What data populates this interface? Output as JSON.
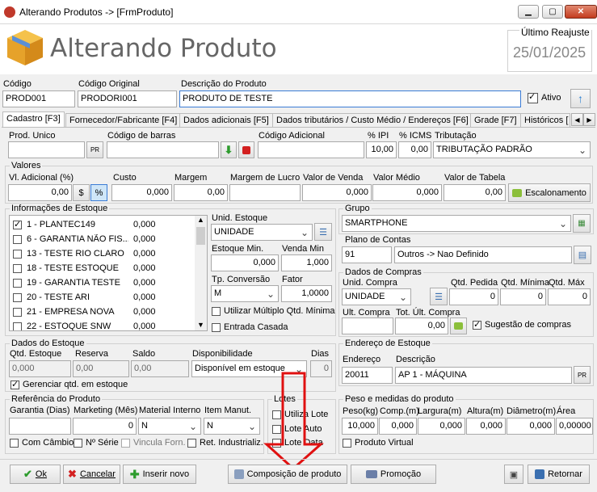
{
  "window": {
    "title": "Alterando Produtos   ->   [FrmProduto]",
    "min": "▁",
    "max": "▢",
    "close": "✕"
  },
  "header": {
    "title": "Alterando Produto",
    "reajuste_label": "Último Reajuste",
    "reajuste_value": "25/01/2025"
  },
  "top": {
    "codigo_label": "Código",
    "codigo": "PROD001",
    "codorig_label": "Código Original",
    "codorig": "PRODORI001",
    "desc_label": "Descrição do Produto",
    "desc": "PRODUTO DE TESTE",
    "ativo_label": "Ativo"
  },
  "tabs": [
    "Cadastro [F3]",
    "Fornecedor/Fabricante [F4]",
    "Dados adicionais [F5]",
    "Dados tributários / Custo Médio / Endereços [F6]",
    "Grade [F7]",
    "Históricos ["
  ],
  "row1": {
    "prod_unico": "Prod. Unico",
    "pr": "PR",
    "codbarras": "Código de barras",
    "codadic": "Código Adicional",
    "ipi_label": "% IPI",
    "ipi": "10,00",
    "icms_label": "% ICMS",
    "icms": "0,00",
    "trib_label": "Tributação",
    "trib": "TRIBUTAÇÃO PADRÃO"
  },
  "valores": {
    "title": "Valores",
    "adic_label": "Vl. Adicional (%)",
    "adic": "0,00",
    "dollar": "$",
    "pct": "%",
    "custo_label": "Custo",
    "custo": "0,000",
    "margem_label": "Margem",
    "margem": "0,00",
    "margemlucro_label": "Margem de Lucro",
    "margemlucro": "",
    "venda_label": "Valor de Venda",
    "venda": "0,000",
    "medio_label": "Valor Médio",
    "medio": "0,000",
    "tabela_label": "Valor de Tabela",
    "tabela": "0,00",
    "escal": "Escalonamento"
  },
  "estoque": {
    "title": "Informações de Estoque",
    "items": [
      {
        "name": "1 - PLANTEC149",
        "qty": "0,000",
        "checked": true
      },
      {
        "name": "6 - GARANTIA NÃO FIS...",
        "qty": "0,000",
        "checked": false
      },
      {
        "name": "13 - TESTE RIO CLARO",
        "qty": "0,000",
        "checked": false
      },
      {
        "name": "18 - TESTE ESTOQUE",
        "qty": "0,000",
        "checked": false
      },
      {
        "name": "19 - GARANTIA TESTE",
        "qty": "0,000",
        "checked": false
      },
      {
        "name": "20 - TESTE ARI",
        "qty": "0,000",
        "checked": false
      },
      {
        "name": "21 - EMPRESA NOVA",
        "qty": "0,000",
        "checked": false
      },
      {
        "name": "22 - ESTOQUE SNW",
        "qty": "0,000",
        "checked": false
      }
    ],
    "unid_label": "Unid. Estoque",
    "unid": "UNIDADE",
    "emin_label": "Estoque Min.",
    "emin": "0,000",
    "vmin_label": "Venda Min",
    "vmin": "1,000",
    "tpconv_label": "Tp. Conversão",
    "tpconv": "M",
    "fator_label": "Fator",
    "fator": "1,0000",
    "multiplo": "Utilizar Múltiplo Qtd. Mínima",
    "casada": "Entrada Casada"
  },
  "grupo": {
    "title": "Grupo",
    "value": "SMARTPHONE"
  },
  "plano": {
    "title": "Plano de Contas",
    "code": "91",
    "value": "Outros -> Nao Definido"
  },
  "compras": {
    "title": "Dados de Compras",
    "unid_label": "Unid. Compra",
    "unid": "UNIDADE",
    "pedida_label": "Qtd. Pedida",
    "pedida": "0",
    "minima_label": "Qtd. Mínima",
    "minima": "0",
    "max_label": "Qtd. Máx",
    "max": "0",
    "ult_label": "Ult. Compra",
    "ult": "",
    "tot_label": "Tot. Últ. Compra",
    "tot": "0,00",
    "sugestao": "Sugestão de compras"
  },
  "endereco": {
    "title": "Endereço de Estoque",
    "end_label": "Endereço",
    "end": "20011",
    "desc_label": "Descrição",
    "desc": "AP 1 - MÁQUINA",
    "pr": "PR"
  },
  "dadosestoque": {
    "title": "Dados do Estoque",
    "qtd_label": "Qtd. Estoque",
    "qtd": "0,000",
    "reserva_label": "Reserva",
    "reserva": "0,00",
    "saldo_label": "Saldo",
    "saldo": "0,00",
    "disp_label": "Disponibilidade",
    "disp": "Disponível em estoque",
    "dias_label": "Dias",
    "dias": "0",
    "gerenciar": "Gerenciar qtd. em estoque"
  },
  "ref": {
    "title": "Referência do Produto",
    "garantia_label": "Garantia (Dias)",
    "garantia": "",
    "mkt_label": "Marketing (Mês)",
    "mkt": "0",
    "matint_label": "Material Interno",
    "matint": "N",
    "manut_label": "Item Manut.",
    "manut": "N",
    "cambio": "Com Câmbio",
    "serie": "Nº Série",
    "vinc": "Vincula Forn.",
    "ret": "Ret. Industrializ."
  },
  "lotes": {
    "title": "Lotes",
    "l1": "Utiliza Lote",
    "l2": "Lote Auto",
    "l3": "Lote Data"
  },
  "peso": {
    "title": "Peso e medidas do produto",
    "peso_label": "Peso(kg)",
    "peso": "10,000",
    "comp_label": "Comp.(m)",
    "comp": "0,000",
    "larg_label": "Largura(m)",
    "larg": "0,000",
    "alt_label": "Altura(m)",
    "alt": "0,000",
    "diam_label": "Diâmetro(m)",
    "diam": "0,000",
    "area_label": "Área",
    "area": "0,00000",
    "virtual": "Produto Virtual"
  },
  "footer": {
    "ok": "Ok",
    "cancelar": "Cancelar",
    "inserir": "Inserir novo",
    "composicao": "Composição de produto",
    "promocao": "Promoção",
    "retornar": "Retornar"
  }
}
